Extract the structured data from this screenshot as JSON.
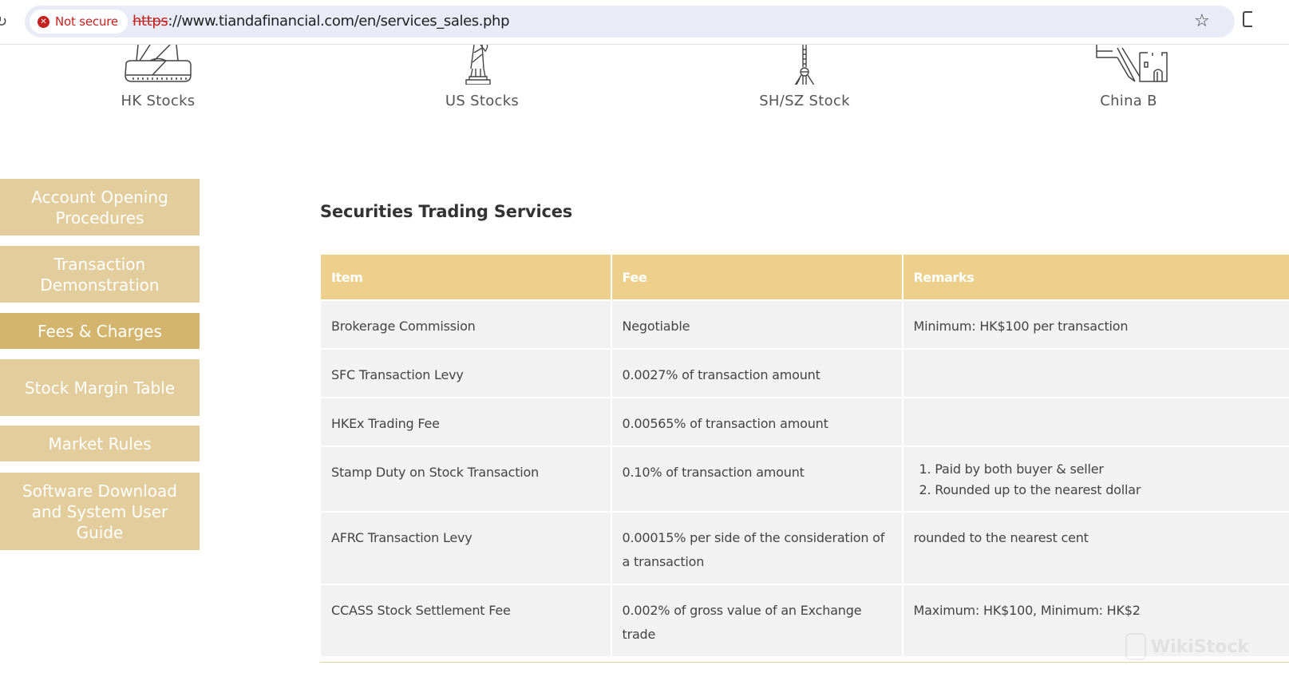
{
  "browser": {
    "security_label": "Not secure",
    "url_scheme": "https",
    "url_rest": "://www.tiandafinancial.com/en/services_sales.php"
  },
  "categories": [
    {
      "label": "HK Stocks",
      "icon": "buddha-statue-icon"
    },
    {
      "label": "US Stocks",
      "icon": "statue-of-liberty-icon"
    },
    {
      "label": "SH/SZ Stock",
      "icon": "oriental-pearl-tower-icon"
    },
    {
      "label": "China B",
      "icon": "great-wall-icon"
    }
  ],
  "sidebar": {
    "items": [
      {
        "label": "Account Opening Procedures",
        "active": false
      },
      {
        "label": "Transaction Demonstration",
        "active": false
      },
      {
        "label": "Fees & Charges",
        "active": true
      },
      {
        "label": "Stock Margin Table",
        "active": false
      },
      {
        "label": "Market Rules",
        "active": false
      },
      {
        "label": "Software Download and System User Guide",
        "active": false
      }
    ]
  },
  "main": {
    "title": "Securities Trading Services",
    "table": {
      "headers": [
        "Item",
        "Fee",
        "Remarks"
      ],
      "rows": [
        {
          "item": "Brokerage Commission",
          "fee": "Negotiable",
          "remarks": [
            "Minimum: HK$100 per transaction"
          ]
        },
        {
          "item": "SFC Transaction Levy",
          "fee": "0.0027% of transaction amount",
          "remarks": []
        },
        {
          "item": "HKEx Trading Fee",
          "fee": "0.00565% of transaction amount",
          "remarks": []
        },
        {
          "item": "Stamp Duty on Stock Transaction",
          "fee": "0.10% of transaction amount",
          "remarks": [
            "1. Paid by both buyer & seller",
            "2. Rounded up to the nearest dollar"
          ]
        },
        {
          "item": "AFRC Transaction Levy",
          "fee": "0.00015% per side of the consideration of a transaction",
          "remarks": [
            "rounded to the nearest cent"
          ]
        },
        {
          "item": "CCASS Stock Settlement Fee",
          "fee": "0.002% of gross value of an Exchange trade",
          "remarks": [
            "Maximum: HK$100, Minimum: HK$2"
          ]
        }
      ]
    }
  },
  "watermark": "WikiStock",
  "colors": {
    "header_gold": "#edd08c",
    "sidebar_gold": "#e3cd9d",
    "sidebar_active": "#d4b56d",
    "row_bg": "#f2f2f2",
    "insecure_red": "#c5221f"
  }
}
